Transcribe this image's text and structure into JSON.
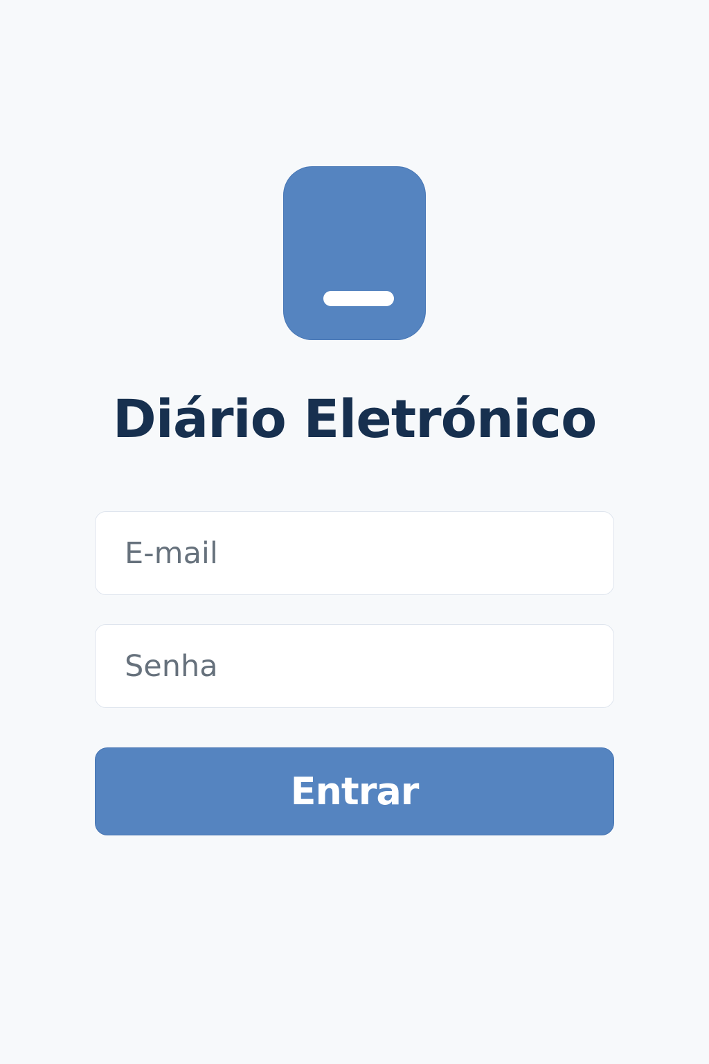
{
  "app": {
    "title": "Diário Eletrónico",
    "logo_icon": "book-icon"
  },
  "login_form": {
    "email": {
      "placeholder": "E-mail",
      "value": ""
    },
    "password": {
      "placeholder": "Senha",
      "value": ""
    },
    "submit_label": "Entrar"
  },
  "colors": {
    "background": "#f7f9fb",
    "accent": "#5584c0",
    "title": "#17304f",
    "placeholder": "#66717c",
    "field_border": "#dfe5ee"
  }
}
